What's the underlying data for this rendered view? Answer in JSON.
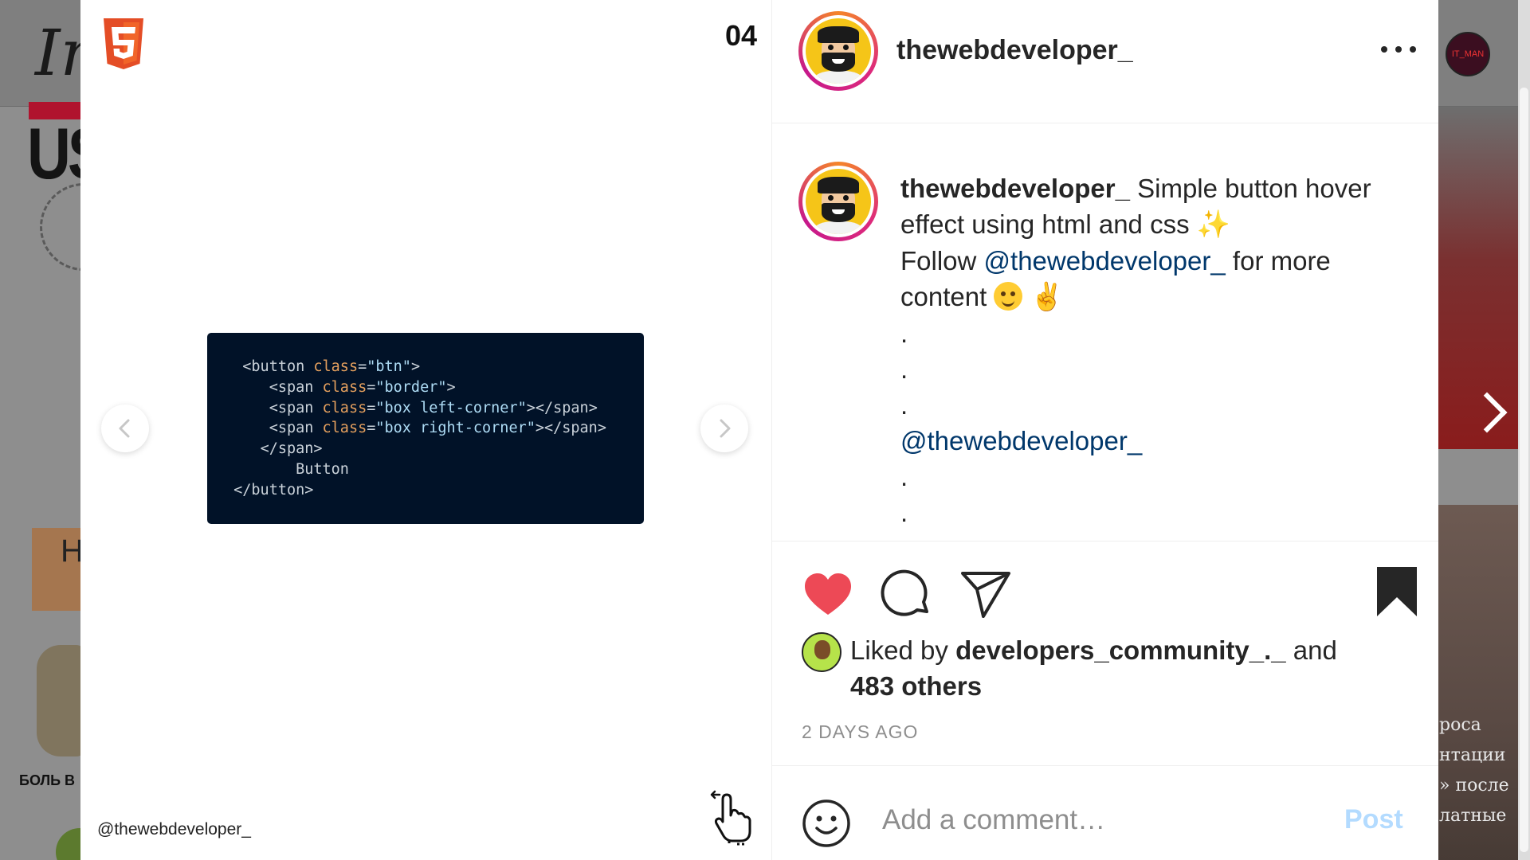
{
  "background": {
    "logo_text": "In",
    "headline_text": "US",
    "tile_letter": "H",
    "tile_caption": "БОЛЬ В",
    "right_avatar_text": "IT_MAN",
    "right_lines": [
      "роса",
      "нтации",
      "» после",
      "латные"
    ]
  },
  "media": {
    "slide_number": "04",
    "handle": "@thewebdeveloper_",
    "code_lines": [
      {
        "indent": "  ",
        "parts": [
          {
            "t": "tag",
            "v": "<button "
          },
          {
            "t": "attr",
            "v": "class"
          },
          {
            "t": "tag",
            "v": "="
          },
          {
            "t": "str",
            "v": "\"btn\""
          },
          {
            "t": "tag",
            "v": ">"
          }
        ]
      },
      {
        "indent": "     ",
        "parts": [
          {
            "t": "tag",
            "v": "<span "
          },
          {
            "t": "attr",
            "v": "class"
          },
          {
            "t": "tag",
            "v": "="
          },
          {
            "t": "str",
            "v": "\"border\""
          },
          {
            "t": "tag",
            "v": ">"
          }
        ]
      },
      {
        "indent": "     ",
        "parts": [
          {
            "t": "tag",
            "v": "<span "
          },
          {
            "t": "attr",
            "v": "class"
          },
          {
            "t": "tag",
            "v": "="
          },
          {
            "t": "str",
            "v": "\"box left-corner\""
          },
          {
            "t": "tag",
            "v": "></span>"
          }
        ]
      },
      {
        "indent": "     ",
        "parts": [
          {
            "t": "tag",
            "v": "<span "
          },
          {
            "t": "attr",
            "v": "class"
          },
          {
            "t": "tag",
            "v": "="
          },
          {
            "t": "str",
            "v": "\"box right-corner\""
          },
          {
            "t": "tag",
            "v": "></span>"
          }
        ]
      },
      {
        "indent": "    ",
        "parts": [
          {
            "t": "tag",
            "v": "</span>"
          }
        ]
      },
      {
        "indent": "        ",
        "parts": [
          {
            "t": "tag",
            "v": "Button"
          }
        ]
      },
      {
        "indent": " ",
        "parts": [
          {
            "t": "tag",
            "v": "</button>"
          }
        ]
      }
    ]
  },
  "post": {
    "username": "thewebdeveloper_",
    "caption": {
      "username": "thewebdeveloper_",
      "line1": " Simple button hover effect using html and css ",
      "follow_prefix": "Follow ",
      "mention": "@thewebdeveloper_",
      "follow_suffix": " for more content ",
      "dot": ".",
      "mention2": "@thewebdeveloper_"
    },
    "liked_by_prefix": "Liked by ",
    "liked_by_user": "developers_community_._",
    "liked_by_mid": " and ",
    "liked_by_others": "483 others",
    "time": "2 DAYS AGO",
    "comment_placeholder": "Add a comment…",
    "post_label": "Post"
  },
  "colors": {
    "like_red": "#ed4956",
    "mention_blue": "#00376b",
    "post_disabled_blue": "#b3dbff",
    "code_bg": "#011228"
  }
}
